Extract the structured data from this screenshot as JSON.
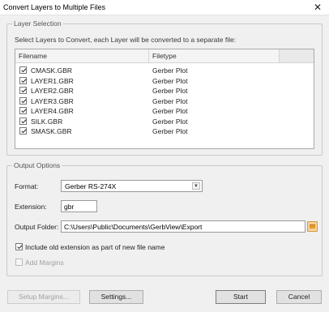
{
  "window": {
    "title": "Convert Layers to Multiple Files",
    "close_glyph": "✕"
  },
  "layer_selection": {
    "legend": "Layer Selection",
    "instruction": "Select Layers to Convert, each Layer will be converted to a separate file:",
    "columns": {
      "filename": "Filename",
      "filetype": "Filetype"
    },
    "rows": [
      {
        "checked": true,
        "filename": "CMASK.GBR",
        "filetype": "Gerber Plot"
      },
      {
        "checked": true,
        "filename": "LAYER1.GBR",
        "filetype": "Gerber Plot"
      },
      {
        "checked": true,
        "filename": "LAYER2.GBR",
        "filetype": "Gerber Plot"
      },
      {
        "checked": true,
        "filename": "LAYER3.GBR",
        "filetype": "Gerber Plot"
      },
      {
        "checked": true,
        "filename": "LAYER4.GBR",
        "filetype": "Gerber Plot"
      },
      {
        "checked": true,
        "filename": "SILK.GBR",
        "filetype": "Gerber Plot"
      },
      {
        "checked": true,
        "filename": "SMASK.GBR",
        "filetype": "Gerber Plot"
      }
    ]
  },
  "output_options": {
    "legend": "Output Options",
    "format_label": "Format:",
    "format_value": "Gerber RS-274X",
    "extension_label": "Extension:",
    "extension_value": "gbr",
    "folder_label": "Output Folder:",
    "folder_value": "C:\\Users\\Public\\Documents\\GerbView\\Export",
    "include_ext_label": "Include old extension as part of new file name",
    "include_ext_checked": true,
    "add_margins_label": "Add Margins",
    "add_margins_checked": false
  },
  "buttons": {
    "setup_margins": "Setup Margins...",
    "settings": "Settings...",
    "start": "Start",
    "cancel": "Cancel"
  },
  "colors": {
    "folder_icon": "#e39b2e",
    "background": "#f0f0f0"
  }
}
